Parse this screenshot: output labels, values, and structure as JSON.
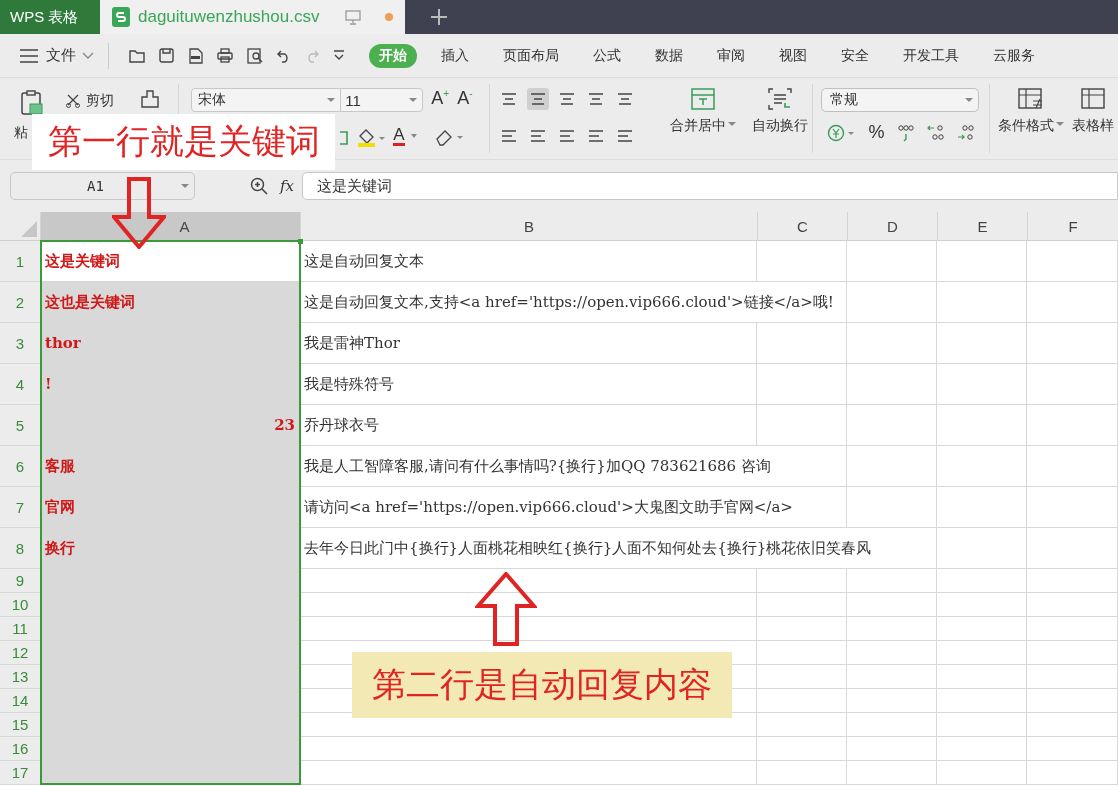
{
  "app_tab": "WPS 表格",
  "file_tab": {
    "name": "daguituwenzhushou.csv",
    "unsaved": true
  },
  "menu": {
    "file": "文件",
    "tabs": [
      {
        "label": "开始",
        "selected": true
      },
      {
        "label": "插入",
        "selected": false
      },
      {
        "label": "页面布局",
        "selected": false
      },
      {
        "label": "公式",
        "selected": false
      },
      {
        "label": "数据",
        "selected": false
      },
      {
        "label": "审阅",
        "selected": false
      },
      {
        "label": "视图",
        "selected": false
      },
      {
        "label": "安全",
        "selected": false
      },
      {
        "label": "开发工具",
        "selected": false
      },
      {
        "label": "云服务",
        "selected": false
      }
    ]
  },
  "ribbon": {
    "paste": "粘",
    "cut": "剪切",
    "font_name": "宋体",
    "font_size": "11",
    "grow_font": "A$^{+}$",
    "shrink_font": "A$^{-}$",
    "font_color": "A",
    "merge": "合并居中",
    "wrap": "自动换行",
    "number_format": "常规",
    "percent": "%",
    "conditional": "条件格式",
    "table_style": "表格样"
  },
  "formula_bar": {
    "cell": "A1",
    "fx": "fx",
    "formula": "这是关键词"
  },
  "columns": [
    {
      "label": "A",
      "selected": true
    },
    {
      "label": "B",
      "selected": false
    },
    {
      "label": "C",
      "selected": false
    },
    {
      "label": "D",
      "selected": false
    },
    {
      "label": "E",
      "selected": false
    },
    {
      "label": "F",
      "selected": false
    }
  ],
  "rows": [
    {
      "number": "1",
      "cells": [
        {
          "text": "这是关键词",
          "kind": "text",
          "active": true
        },
        {
          "text": "这是自动回复文本"
        }
      ]
    },
    {
      "number": "2",
      "cells": [
        {
          "text": "这也是关键词",
          "kind": "text",
          "active": false
        },
        {
          "text": "这是自动回复文本,支持<a href='https://open.vip666.cloud'>链接</a>哦!"
        }
      ]
    },
    {
      "number": "3",
      "cells": [
        {
          "text": "thor",
          "kind": "text",
          "active": false
        },
        {
          "text": "我是雷神Thor"
        }
      ]
    },
    {
      "number": "4",
      "cells": [
        {
          "text": "!",
          "kind": "text",
          "active": false
        },
        {
          "text": "我是特殊符号"
        }
      ]
    },
    {
      "number": "5",
      "cells": [
        {
          "text": "23",
          "kind": "number",
          "active": false
        },
        {
          "text": "乔丹球衣号"
        }
      ]
    },
    {
      "number": "6",
      "cells": [
        {
          "text": "客服",
          "kind": "text",
          "active": false
        },
        {
          "text": "我是人工智障客服,请问有什么事情吗?{换行}加QQ 783621686 咨询"
        }
      ]
    },
    {
      "number": "7",
      "cells": [
        {
          "text": "官网",
          "kind": "text",
          "active": false
        },
        {
          "text": "请访问<a href='https://open.vip666.cloud'>大鬼图文助手官网</a>"
        }
      ]
    },
    {
      "number": "8",
      "cells": [
        {
          "text": "换行",
          "kind": "text",
          "active": false
        },
        {
          "text": "去年今日此门中{换行}人面桃花相映红{换行}人面不知何处去{换行}桃花依旧笑春风"
        }
      ]
    },
    {
      "number": "9"
    },
    {
      "number": "10"
    },
    {
      "number": "11"
    },
    {
      "number": "12"
    },
    {
      "number": "13"
    },
    {
      "number": "14"
    },
    {
      "number": "15"
    },
    {
      "number": "16"
    },
    {
      "number": "17"
    }
  ],
  "annotations": [
    {
      "text": "第一行就是关键词",
      "kind": "down"
    },
    {
      "text": "第二行是自动回复内容",
      "kind": "up"
    }
  ]
}
